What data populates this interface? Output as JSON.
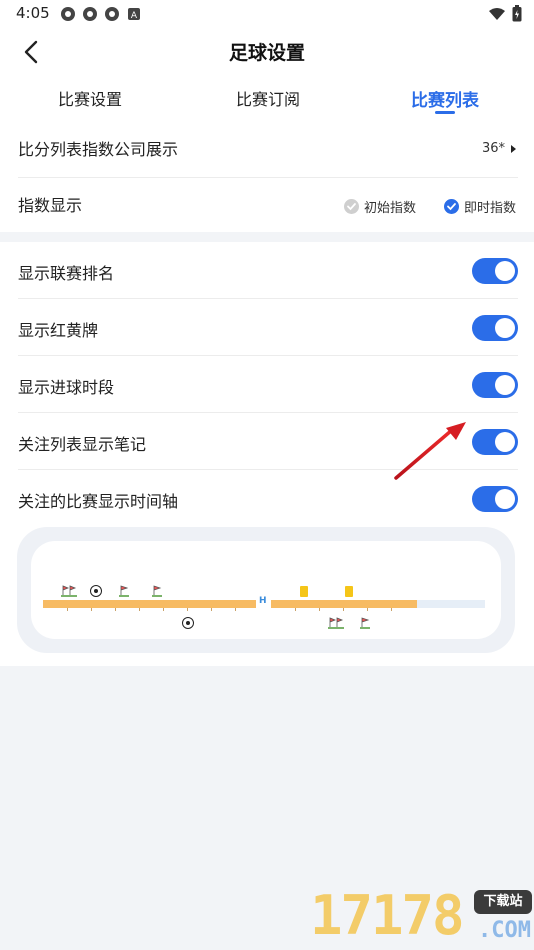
{
  "status_bar": {
    "time": "4:05",
    "icons": [
      "notification-icon",
      "notification-icon",
      "notification-icon",
      "a-icon"
    ],
    "right_icons": [
      "wifi-icon",
      "battery-icon"
    ]
  },
  "header": {
    "title": "足球设置",
    "back_icon": "chevron-left-icon"
  },
  "tabs": [
    {
      "label": "比赛设置",
      "active": false
    },
    {
      "label": "比赛订阅",
      "active": false
    },
    {
      "label": "比赛列表",
      "active": true
    }
  ],
  "settings": {
    "index_company": {
      "label": "比分列表指数公司展示",
      "value": "36*"
    },
    "index_display": {
      "label": "指数显示",
      "options": [
        {
          "label": "初始指数",
          "checked": false
        },
        {
          "label": "即时指数",
          "checked": true
        }
      ]
    }
  },
  "toggles": [
    {
      "label": "显示联赛排名",
      "on": true
    },
    {
      "label": "显示红黄牌",
      "on": true
    },
    {
      "label": "显示进球时段",
      "on": true
    },
    {
      "label": "关注列表显示笔记",
      "on": true
    },
    {
      "label": "关注的比赛显示时间轴",
      "on": true
    }
  ],
  "timeline": {
    "half_marker": "H",
    "top_events": [
      "corner-flags-icon",
      "football-icon",
      "corner-flag-icon",
      "corner-flag-icon",
      "yellow-card-icon",
      "yellow-card-icon"
    ],
    "bottom_events": [
      "football-icon",
      "corner-flags-icon",
      "corner-flag-icon"
    ]
  },
  "watermark": {
    "number": "17178",
    "tag": "下载站",
    "domain": ".COM"
  },
  "colors": {
    "accent": "#2b6de8",
    "timeline_bar": "#f7bb63",
    "yellow_card": "#f5c518"
  }
}
